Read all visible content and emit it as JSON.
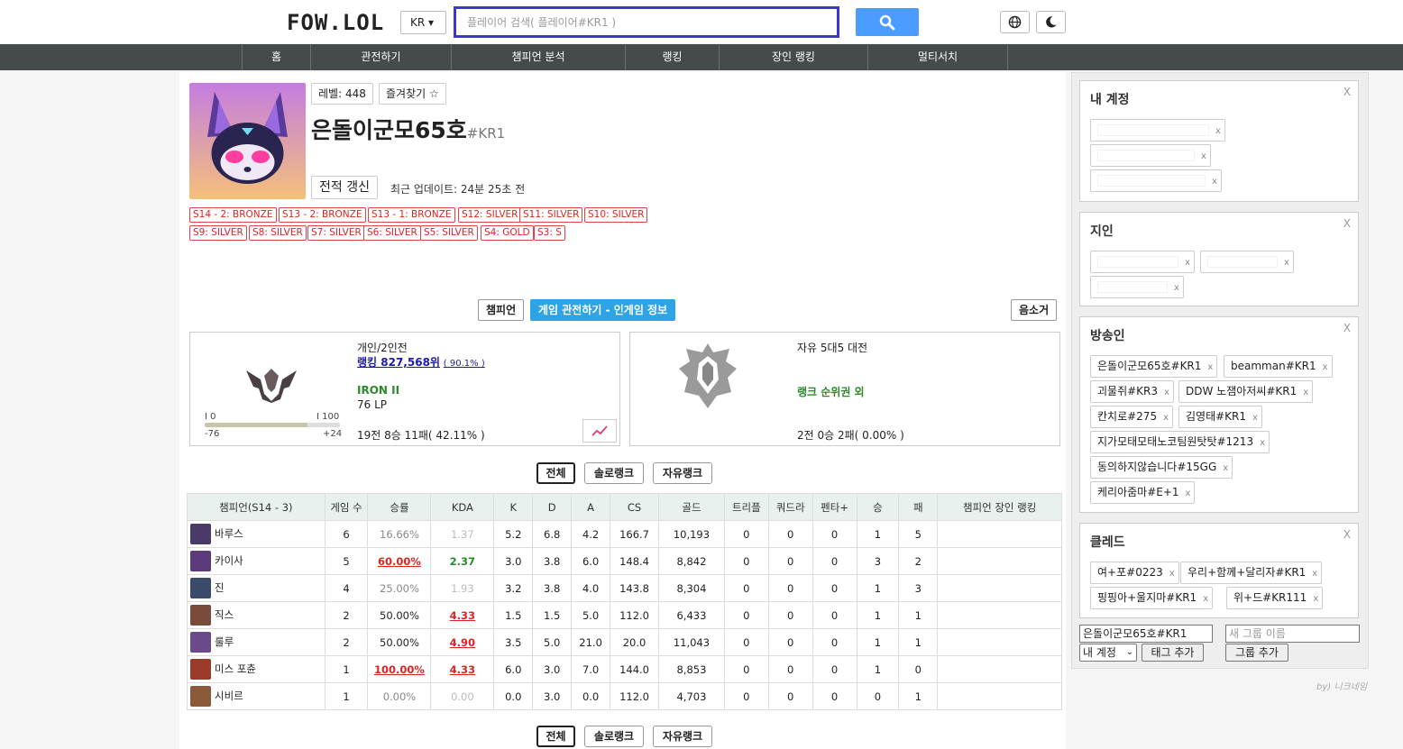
{
  "header": {
    "logo": "FOW.LOL",
    "region": "KR ▾",
    "search_placeholder": "플레이어 검색( 플레이어#KR1 )"
  },
  "nav": [
    "홈",
    "관전하기",
    "챔피언 분석",
    "랭킹",
    "장인 랭킹",
    "멀티서치"
  ],
  "profile": {
    "level": "레벨: 448",
    "favorite": "즐겨찾기 ☆",
    "name": "은돌이군모65호",
    "tag": "#KR1",
    "refresh": "전적 갱신",
    "updated": "최근 업데이트: 24분 25초 전",
    "seasons_row1": [
      "S14 - 2: BRONZE",
      "S13 - 2: BRONZE",
      "S13 - 1: BRONZE",
      "S12: SILVER",
      "S11: SILVER",
      "S10: SILVER"
    ],
    "seasons_row2": [
      "S9: SILVER",
      "S8: SILVER",
      "S7: SILVER",
      "S6: SILVER",
      "S5: SILVER",
      "S4: GOLD",
      "S3: S"
    ]
  },
  "tabs": {
    "champion": "챔피언",
    "spectate": "게임 관전하기 - 인게임 정보",
    "summoner": "음소거"
  },
  "solo": {
    "queue": "개인/2인전",
    "ranking": "랭킹 827,568위",
    "percent": "( 90.1% )",
    "tier": "IRON II",
    "lp": "76 LP",
    "record": "19전 8승 11패( 42.11% )",
    "bar_left": "I 0",
    "bar_right": "I 100",
    "bar_low": "-76",
    "bar_high": "+24",
    "progress": 0.76
  },
  "flex": {
    "queue": "자유 5대5 대전",
    "status": "랭크 순위권 외",
    "record": "2전 0승 2패( 0.00% )"
  },
  "filters": [
    "전체",
    "솔로랭크",
    "자유랭크"
  ],
  "table": {
    "headers": [
      "챔피언(S14 - 3)",
      "게임 수",
      "승률",
      "KDA",
      "K",
      "D",
      "A",
      "CS",
      "골드",
      "트리플",
      "쿼드라",
      "펜타+",
      "승",
      "패",
      "챔피언 장인 랭킹"
    ],
    "rows": [
      {
        "champ": "바루스",
        "color": "#4a3a6a",
        "games": "6",
        "wr": "16.66%",
        "wr_style": "wr-gray",
        "kda": "1.37",
        "kda_style": "kda-gray",
        "k": "5.2",
        "d": "6.8",
        "a": "4.2",
        "cs": "166.7",
        "gold": "10,193",
        "triple": "0",
        "quadra": "0",
        "penta": "0",
        "win": "1",
        "loss": "5"
      },
      {
        "champ": "카이사",
        "color": "#5a3a7a",
        "games": "5",
        "wr": "60.00%",
        "wr_style": "wr-red",
        "kda": "2.37",
        "kda_style": "kda-green",
        "k": "3.0",
        "d": "3.8",
        "a": "6.0",
        "cs": "148.4",
        "gold": "8,842",
        "triple": "0",
        "quadra": "0",
        "penta": "0",
        "win": "3",
        "loss": "2"
      },
      {
        "champ": "진",
        "color": "#3a4a6a",
        "games": "4",
        "wr": "25.00%",
        "wr_style": "wr-gray",
        "kda": "1.93",
        "kda_style": "kda-gray",
        "k": "3.2",
        "d": "3.8",
        "a": "4.0",
        "cs": "143.8",
        "gold": "8,304",
        "triple": "0",
        "quadra": "0",
        "penta": "0",
        "win": "1",
        "loss": "3"
      },
      {
        "champ": "직스",
        "color": "#7a4a3a",
        "games": "2",
        "wr": "50.00%",
        "wr_style": "",
        "kda": "4.33",
        "kda_style": "kda-red",
        "k": "1.5",
        "d": "1.5",
        "a": "5.0",
        "cs": "112.0",
        "gold": "6,433",
        "triple": "0",
        "quadra": "0",
        "penta": "0",
        "win": "1",
        "loss": "1"
      },
      {
        "champ": "룰루",
        "color": "#6a4a8a",
        "games": "2",
        "wr": "50.00%",
        "wr_style": "",
        "kda": "4.90",
        "kda_style": "kda-red",
        "k": "3.5",
        "d": "5.0",
        "a": "21.0",
        "cs": "20.0",
        "gold": "11,043",
        "triple": "0",
        "quadra": "0",
        "penta": "0",
        "win": "1",
        "loss": "1"
      },
      {
        "champ": "미스 포츈",
        "color": "#9a3a2a",
        "games": "1",
        "wr": "100.00%",
        "wr_style": "wr-red",
        "kda": "4.33",
        "kda_style": "kda-red",
        "k": "6.0",
        "d": "3.0",
        "a": "7.0",
        "cs": "144.0",
        "gold": "8,853",
        "triple": "0",
        "quadra": "0",
        "penta": "0",
        "win": "1",
        "loss": "0"
      },
      {
        "champ": "시비르",
        "color": "#8a5a3a",
        "games": "1",
        "wr": "0.00%",
        "wr_style": "wr-gray",
        "kda": "0.00",
        "kda_style": "kda-gray",
        "k": "0.0",
        "d": "3.0",
        "a": "0.0",
        "cs": "112.0",
        "gold": "4,703",
        "triple": "0",
        "quadra": "0",
        "penta": "0",
        "win": "0",
        "loss": "1"
      }
    ]
  },
  "sidebar": {
    "my_account": {
      "title": "내 계정",
      "close": "X",
      "chip_x": "x"
    },
    "friends": {
      "title": "지인",
      "close": "X"
    },
    "streamers": {
      "title": "방송인",
      "close": "X",
      "chips": [
        "은돌이군모65호#KR1",
        "beamman#KR1",
        "괴물쥐#KR3",
        "DDW 노잼아저씨#KR1",
        "칸치로#275",
        "김영태#KR1",
        "지가모태모태노코팀원탓탓#1213",
        "동의하지않습니다#15GG",
        "케리아줌마#E+1"
      ]
    },
    "clade": {
      "title": "클레드",
      "close": "X",
      "chips": [
        "여+포#0223",
        "우리+함께+달리자#KR1",
        "핑핑아+울지마#KR1",
        "위+드#KR111"
      ]
    },
    "tool": {
      "name_value": "은돌이군모65호#KR1",
      "group_placeholder": "새 그룹 이름",
      "group_select": "내 계정",
      "add_tag": "태그 추가",
      "add_group": "그룹 추가"
    },
    "credit": "by) 니크네임"
  }
}
